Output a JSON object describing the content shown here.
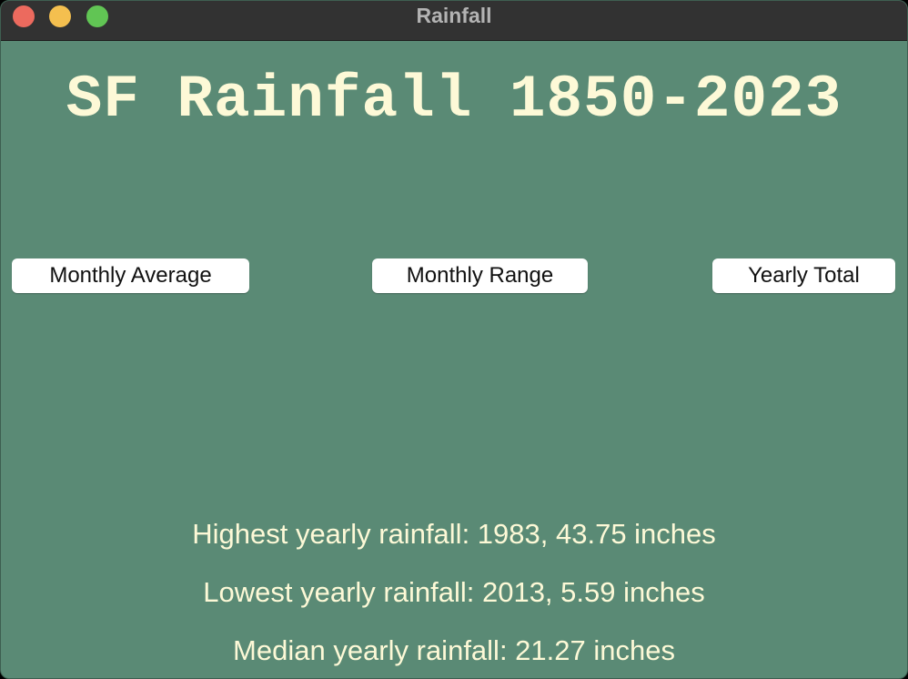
{
  "window": {
    "title": "Rainfall",
    "background_color": "#5a8a75",
    "text_color": "#fdf9d7"
  },
  "traffic_lights": {
    "close_icon": "close-icon",
    "minimize_icon": "minimize-icon",
    "zoom_icon": "zoom-icon"
  },
  "header": {
    "title": "SF Rainfall 1850-2023"
  },
  "buttons": {
    "monthly_average": "Monthly Average",
    "monthly_range": "Monthly Range",
    "yearly_total": "Yearly Total"
  },
  "stats": {
    "highest": "Highest yearly rainfall: 1983, 43.75 inches",
    "lowest": "Lowest yearly rainfall: 2013, 5.59 inches",
    "median": "Median yearly rainfall: 21.27 inches"
  }
}
